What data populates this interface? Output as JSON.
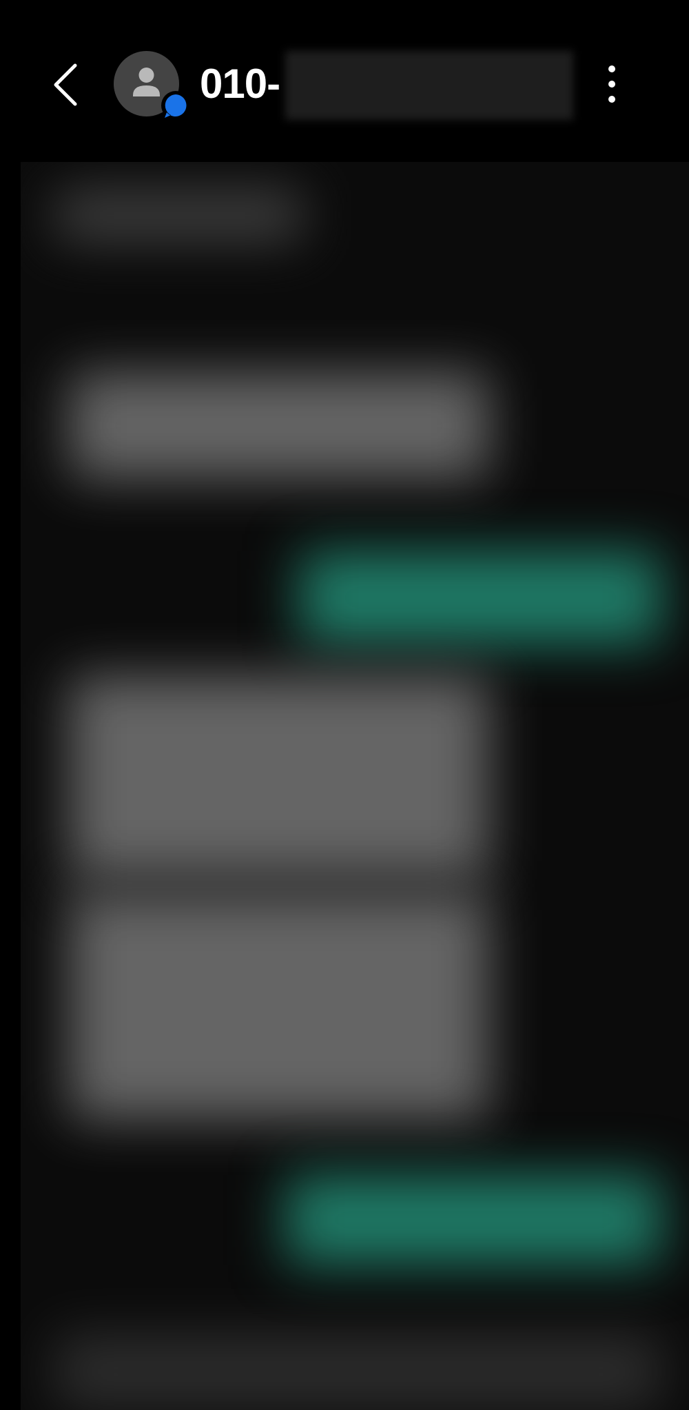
{
  "header": {
    "contact_name": "010-",
    "back_icon": "chevron-left-icon",
    "avatar_icon": "person-icon",
    "badge_icon": "chat-bubble-icon",
    "menu_icon": "more-vertical-icon"
  },
  "conversation": {
    "messages": [
      {
        "direction": "incoming"
      },
      {
        "direction": "incoming"
      },
      {
        "direction": "outgoing"
      },
      {
        "direction": "incoming"
      },
      {
        "direction": "incoming"
      },
      {
        "direction": "outgoing"
      },
      {
        "direction": "incoming"
      }
    ]
  },
  "colors": {
    "background": "#000000",
    "incoming_bubble": "#6a6a6a",
    "outgoing_bubble": "#1f7a66",
    "badge": "#1a73e8"
  }
}
